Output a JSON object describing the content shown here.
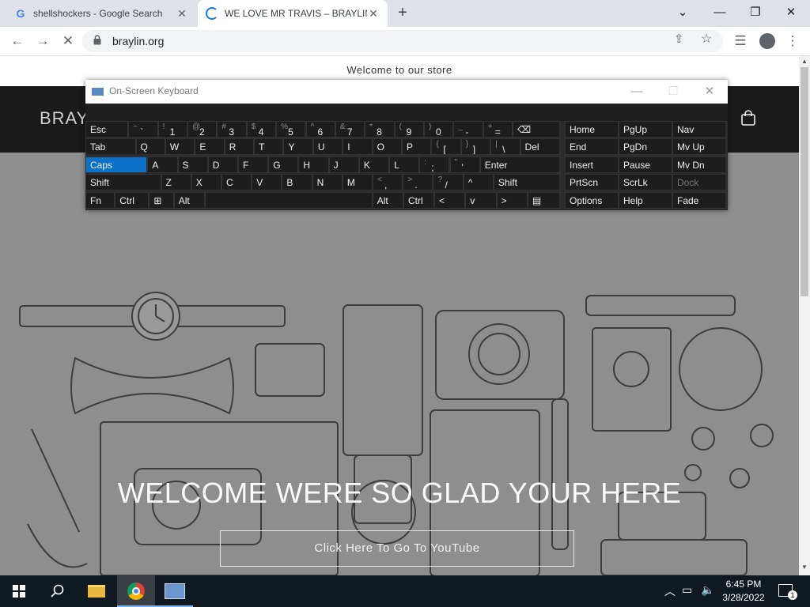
{
  "browser": {
    "tabs": [
      {
        "title": "shellshockers - Google Search",
        "active": false
      },
      {
        "title": "WE LOVE MR TRAVIS – BRAYLIN.O",
        "active": true
      }
    ],
    "new_tab_label": "+",
    "url": "braylin.org"
  },
  "page": {
    "announcement": "Welcome to our store",
    "brand": "BRAYL",
    "hero_title": "WELCOME WERE SO GLAD YOUR HERE",
    "hero_button": "Click Here To Go To YouTube"
  },
  "osk": {
    "title": "On-Screen Keyboard",
    "rows": [
      [
        {
          "label": "Esc",
          "w": 1.45
        },
        {
          "shift": "~",
          "main": "`"
        },
        {
          "shift": "!",
          "main": "1"
        },
        {
          "shift": "@",
          "main": "2"
        },
        {
          "shift": "#",
          "main": "3"
        },
        {
          "shift": "$",
          "main": "4"
        },
        {
          "shift": "%",
          "main": "5"
        },
        {
          "shift": "^",
          "main": "6"
        },
        {
          "shift": "&",
          "main": "7"
        },
        {
          "shift": "*",
          "main": "8"
        },
        {
          "shift": "(",
          "main": "9"
        },
        {
          "shift": ")",
          "main": "0"
        },
        {
          "shift": "_",
          "main": "-"
        },
        {
          "shift": "+",
          "main": "="
        },
        {
          "label": "⌫",
          "w": 1.6
        }
      ],
      [
        {
          "label": "Tab",
          "w": 1.7
        },
        {
          "label": "Q"
        },
        {
          "label": "W"
        },
        {
          "label": "E"
        },
        {
          "label": "R"
        },
        {
          "label": "T"
        },
        {
          "label": "Y"
        },
        {
          "label": "U"
        },
        {
          "label": "I"
        },
        {
          "label": "O"
        },
        {
          "label": "P"
        },
        {
          "shift": "{",
          "main": "["
        },
        {
          "shift": "}",
          "main": "]"
        },
        {
          "shift": "|",
          "main": "\\"
        },
        {
          "label": "Del",
          "w": 1.35
        }
      ],
      [
        {
          "label": "Caps",
          "w": 2.05,
          "selected": true
        },
        {
          "label": "A"
        },
        {
          "label": "S"
        },
        {
          "label": "D"
        },
        {
          "label": "F"
        },
        {
          "label": "G"
        },
        {
          "label": "H"
        },
        {
          "label": "J"
        },
        {
          "label": "K"
        },
        {
          "label": "L"
        },
        {
          "shift": ":",
          "main": ";"
        },
        {
          "shift": "\"",
          "main": "'"
        },
        {
          "label": "Enter",
          "w": 2.65
        }
      ],
      [
        {
          "label": "Shift",
          "w": 2.5
        },
        {
          "label": "Z"
        },
        {
          "label": "X"
        },
        {
          "label": "C"
        },
        {
          "label": "V"
        },
        {
          "label": "B"
        },
        {
          "label": "N"
        },
        {
          "label": "M"
        },
        {
          "shift": "<",
          "main": ","
        },
        {
          "shift": ">",
          "main": "."
        },
        {
          "shift": "?",
          "main": "/"
        },
        {
          "label": "^"
        },
        {
          "label": "Shift",
          "w": 2.2
        }
      ],
      [
        {
          "label": "Fn",
          "w": 0.95
        },
        {
          "label": "Ctrl",
          "w": 1.1
        },
        {
          "label": "⊞",
          "w": 0.8
        },
        {
          "label": "Alt",
          "w": 1.0
        },
        {
          "label": "",
          "w": 5.4
        },
        {
          "label": "Alt",
          "w": 1.0
        },
        {
          "label": "Ctrl",
          "w": 1.0
        },
        {
          "label": "<",
          "w": 1.0
        },
        {
          "label": "v",
          "w": 1.0
        },
        {
          "label": ">",
          "w": 1.0
        },
        {
          "label": "▤",
          "w": 1.05
        }
      ]
    ],
    "nav_rows": [
      [
        "Home",
        "PgUp",
        "Nav"
      ],
      [
        "End",
        "PgDn",
        "Mv Up"
      ],
      [
        "Insert",
        "Pause",
        "Mv Dn"
      ],
      [
        "PrtScn",
        "ScrLk",
        "Dock"
      ],
      [
        "Options",
        "Help",
        "Fade"
      ]
    ]
  },
  "taskbar": {
    "time": "6:45 PM",
    "date": "3/28/2022",
    "notification_count": "1"
  },
  "colors": {
    "osk_selected": "#0a70c8",
    "header_bg": "#1a1a1a",
    "hero_bg": "#8e8e8e"
  }
}
